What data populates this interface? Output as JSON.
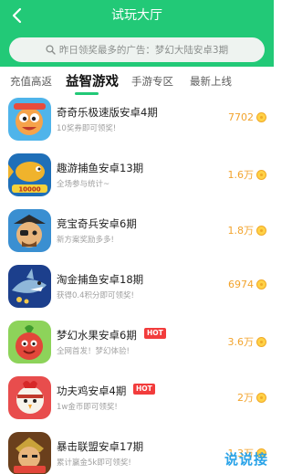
{
  "header": {
    "title": "试玩大厅"
  },
  "search": {
    "placeholder": "昨日领奖最多的广告：梦幻大陆安卓3期"
  },
  "tabs": [
    "充值高返",
    "益智游戏",
    "手游专区",
    "最新上线"
  ],
  "active_tab": "益智游戏",
  "items": [
    {
      "title": "奇奇乐极速版安卓4期",
      "subtitle": "10奖券即可领奖!",
      "reward": "7702",
      "hot": false,
      "icon": "cartoon-creature-icon"
    },
    {
      "title": "趣游捕鱼安卓13期",
      "subtitle": "全场参与统计~",
      "reward": "1.6万",
      "hot": false,
      "icon": "fishing-game-icon"
    },
    {
      "title": "竞宝奇兵安卓6期",
      "subtitle": "新方案奖励多多!",
      "reward": "1.8万",
      "hot": false,
      "icon": "pirate-character-icon"
    },
    {
      "title": "淘金捕鱼安卓18期",
      "subtitle": "获得0.4积分即可领奖!",
      "reward": "6974",
      "hot": false,
      "icon": "shark-icon"
    },
    {
      "title": "梦幻水果安卓6期",
      "subtitle": "全网首发！梦幻体验!",
      "reward": "3.6万",
      "hot": true,
      "hot_label": "HOT",
      "icon": "fruit-character-icon"
    },
    {
      "title": "功夫鸡安卓4期",
      "subtitle": "1w金币即可领奖!",
      "reward": "2万",
      "hot": true,
      "hot_label": "HOT",
      "icon": "kungfu-chicken-icon"
    },
    {
      "title": "暴击联盟安卓17期",
      "subtitle": "累计赢金5k即可领奖!",
      "reward": "1.3万",
      "hot": false,
      "icon": "warrior-icon"
    }
  ],
  "watermark": "说说接",
  "colors": {
    "brand_green": "#22c977",
    "reward_orange": "#f2a32c",
    "hot_red": "#f23c3c",
    "watermark_blue": "#2aa3e8"
  }
}
